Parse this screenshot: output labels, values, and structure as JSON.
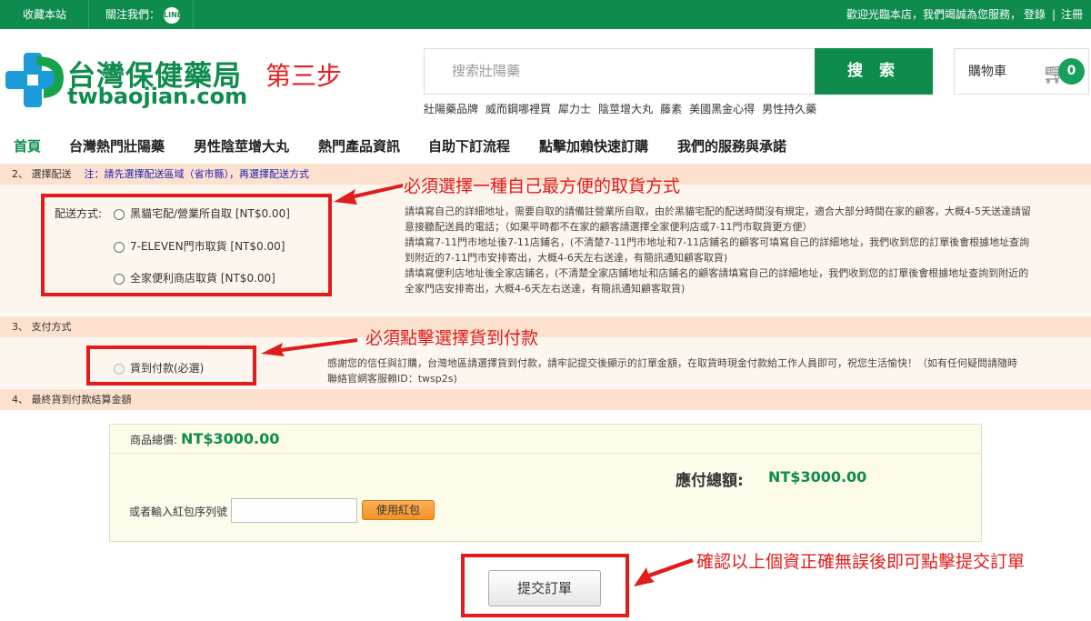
{
  "topbar": {
    "bookmark": "收藏本站",
    "follow": "關注我們：",
    "line_icon_text": "LINE",
    "welcome": "歡迎光臨本店，我們竭誠為您服務，",
    "login": "登錄",
    "divider": "|",
    "register": "注冊"
  },
  "logo": {
    "title": "台灣保健藥局",
    "domain": "twbaojian.com"
  },
  "step_label": "第三步",
  "search": {
    "placeholder": "搜索壯陽藥",
    "button": "搜 索"
  },
  "hot_keywords": [
    "壯陽藥品牌",
    "威而鋼哪裡買",
    "犀力士",
    "陰莖增大丸",
    "藤素",
    "美國黑金心得",
    "男性持久藥"
  ],
  "cart": {
    "label": "購物車",
    "count": "0"
  },
  "nav": [
    "首頁",
    "台灣熱門壯陽藥",
    "男性陰莖增大丸",
    "熱門產品資訊",
    "自助下訂流程",
    "點擊加賴快速訂購",
    "我們的服務與承諾"
  ],
  "section2": {
    "title": "2、 選擇配送",
    "note": "注：請先選擇配送區域（省市縣），再選擇配送方式",
    "ship_label": "配送方式:",
    "options": [
      "黑貓宅配/營業所自取 [NT$0.00]",
      "7-ELEVEN門市取貨 [NT$0.00]",
      "全家便利商店取貨 [NT$0.00]"
    ],
    "desc": [
      "請填寫自己的詳細地址，需要自取的請備註營業所自取，由於黑貓宅配的配送時間沒有規定，適合大部分時間在家的顧客，大概4-5天送達請留",
      "意接聽配送員的電話；（如果平時都不在家的顧客請選擇全家便利店或7-11門市取貨更方便）",
      "請填寫7-11門市地址後7-11店鋪名，(不清楚7-11門市地址和7-11店鋪名的顧客可填寫自己的詳細地址，我們收到您的訂單後會根據地址查詢",
      "到附近的7-11門市安排寄出，大概4-6天左右送達，有簡訊通知顧客取貨)",
      "請填寫便利店地址後全家店鋪名，(不清楚全家店鋪地址和店鋪名的顧客請填寫自己的詳細地址，我們收到您的訂單後會根據地址查詢到附近的",
      "全家門店安排寄出，大概4-6天左右送達，有簡訊通知顧客取貨)"
    ]
  },
  "section3": {
    "title": "3、 支付方式",
    "option": "貨到付款(必選)",
    "desc": [
      "感謝您的信任與訂購，台灣地區請選擇貨到付款，請牢記提交後顯示的訂單金額，在取貨時現金付款給工作人員即可，祝您生活愉快！（如有任何疑問請隨時",
      "聯絡官網客服賴ID：twsp2s)"
    ]
  },
  "section4": {
    "title": "4、 最終貨到付款結算金額",
    "subtotal_label": "商品總價:",
    "subtotal_value": "NT$3000.00",
    "due_label": "應付總額:",
    "due_value": "NT$3000.00",
    "coupon_label": "或者輸入紅包序列號",
    "coupon_button": "使用紅包"
  },
  "submit_button": "提交訂單",
  "annotations": {
    "shipping": "必須選擇一種自己最方便的取貨方式",
    "payment": "必須點擊選擇貨到付款",
    "submit": "確認以上個資正確無誤後即可點擊提交訂單"
  },
  "colors": {
    "brand_green": "#0e8c4e",
    "annotation_red": "#e21b1b",
    "section_header": "#fde1cf"
  }
}
